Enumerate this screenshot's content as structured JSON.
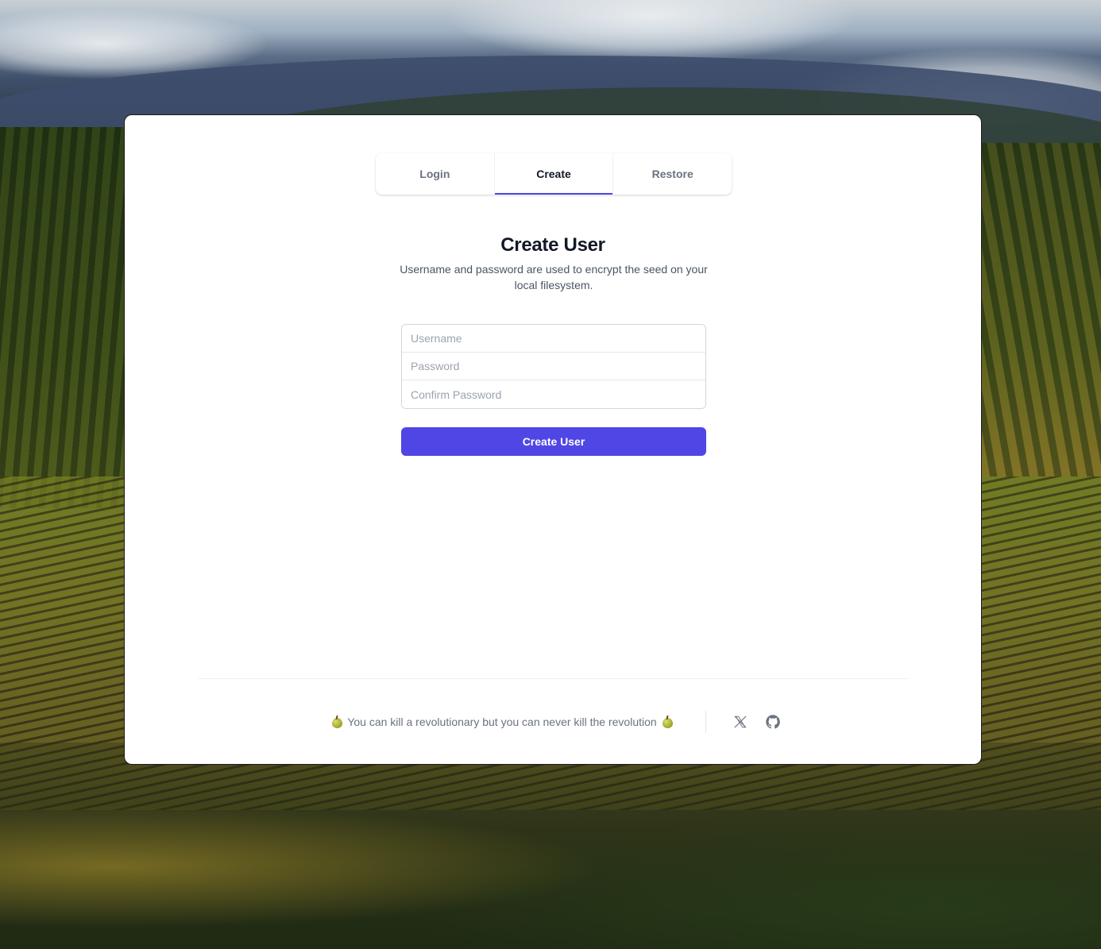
{
  "tabs": [
    {
      "label": "Login",
      "active": false
    },
    {
      "label": "Create",
      "active": true
    },
    {
      "label": "Restore",
      "active": false
    }
  ],
  "form": {
    "title": "Create User",
    "subtitle": "Username and password are used to encrypt the seed on your local filesystem.",
    "username_placeholder": "Username",
    "username_value": "",
    "password_placeholder": "Password",
    "password_value": "",
    "confirm_placeholder": "Confirm Password",
    "confirm_value": "",
    "submit_label": "Create User"
  },
  "footer": {
    "slogan": "You can kill a revolutionary but you can never kill the revolution",
    "slogan_icon": "pear-icon",
    "links": [
      {
        "icon": "x-icon"
      },
      {
        "icon": "github-icon"
      }
    ]
  },
  "colors": {
    "accent": "#4f46e5",
    "heading": "#111827",
    "muted": "#6b7280"
  }
}
